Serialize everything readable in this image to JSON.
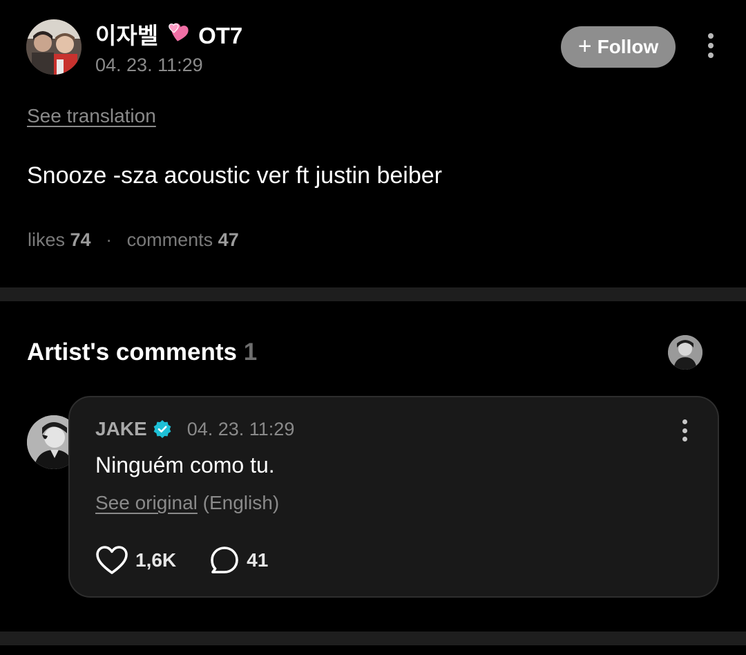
{
  "post": {
    "author_name": "이자벨",
    "author_suffix": "OT7",
    "heart_icon": "two-hearts-icon",
    "date": "04. 23. 11:29",
    "follow_label": "Follow",
    "see_translation": "See translation",
    "text": "Snooze -sza acoustic ver ft justin beiber",
    "likes_label": "likes",
    "likes_count": "74",
    "comments_label": "comments",
    "comments_count": "47"
  },
  "artist_comments": {
    "title": "Artist's comments",
    "count": "1",
    "comment": {
      "author": "JAKE",
      "date": "04. 23. 11:29",
      "text": "Ninguém como tu.",
      "see_original": "See original",
      "original_language": "(English)",
      "likes": "1,6K",
      "replies": "41"
    }
  },
  "colors": {
    "background": "#000000",
    "card": "#191919",
    "divider": "#1e1e1e",
    "verified": "#1ec0d6",
    "follow_button": "#8e8e8e",
    "heart_pink": "#f06fa5"
  }
}
